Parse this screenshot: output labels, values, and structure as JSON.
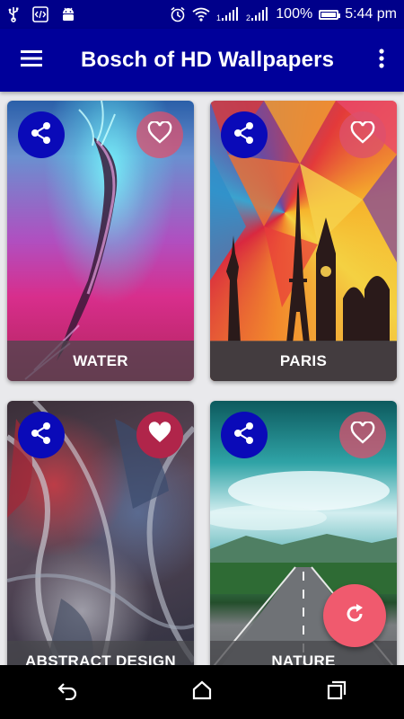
{
  "status_bar": {
    "battery_percent": "100%",
    "time": "5:44 pm",
    "icons": [
      "usb-icon",
      "code-icon",
      "android-icon",
      "alarm-icon",
      "wifi-icon",
      "signal-1-icon",
      "signal-2-icon",
      "battery-icon"
    ]
  },
  "app_bar": {
    "title": "Bosch of HD Wallpapers",
    "icons": [
      "menu-icon",
      "more-vert-icon"
    ]
  },
  "wallpapers": [
    {
      "label": "WATER",
      "favorited": false
    },
    {
      "label": "PARIS",
      "favorited": false
    },
    {
      "label": "ABSTRACT DESIGN",
      "favorited": true
    },
    {
      "label": "NATURE",
      "favorited": false
    }
  ],
  "fab": {
    "icon": "refresh-icon"
  },
  "nav_bar": {
    "icons": [
      "back-icon",
      "home-icon",
      "recents-icon"
    ]
  },
  "colors": {
    "primary": "#00009a",
    "status_bar": "#00008a",
    "share_button": "#0a0ab8",
    "fab": "#f05a6e",
    "favorite_active": "#b0254a"
  }
}
